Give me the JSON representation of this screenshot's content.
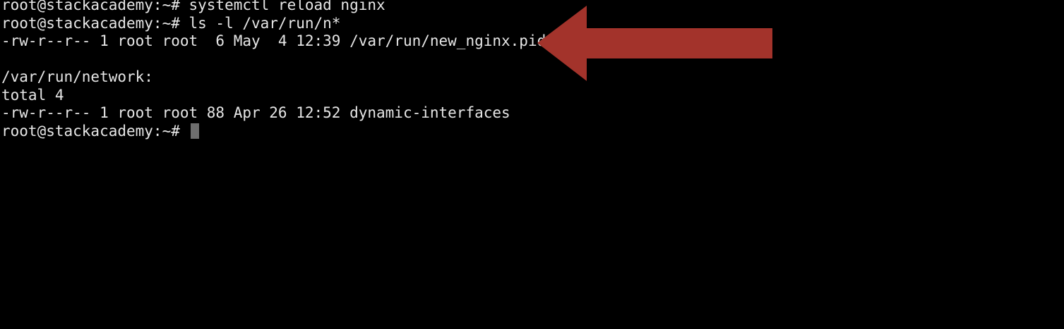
{
  "terminal": {
    "lines": [
      "root@stackacademy:~# systemctl reload nginx",
      "root@stackacademy:~# ls -l /var/run/n*",
      "-rw-r--r-- 1 root root  6 May  4 12:39 /var/run/new_nginx.pid",
      "",
      "/var/run/network:",
      "total 4",
      "-rw-r--r-- 1 root root 88 Apr 26 12:52 dynamic-interfaces"
    ],
    "prompt": "root@stackacademy:~# "
  },
  "colors": {
    "background": "#000000",
    "text": "#e6e6e6",
    "cursor": "#6e6e6e",
    "arrow": "#a3332b"
  },
  "annotation_icon": "left-arrow-icon"
}
